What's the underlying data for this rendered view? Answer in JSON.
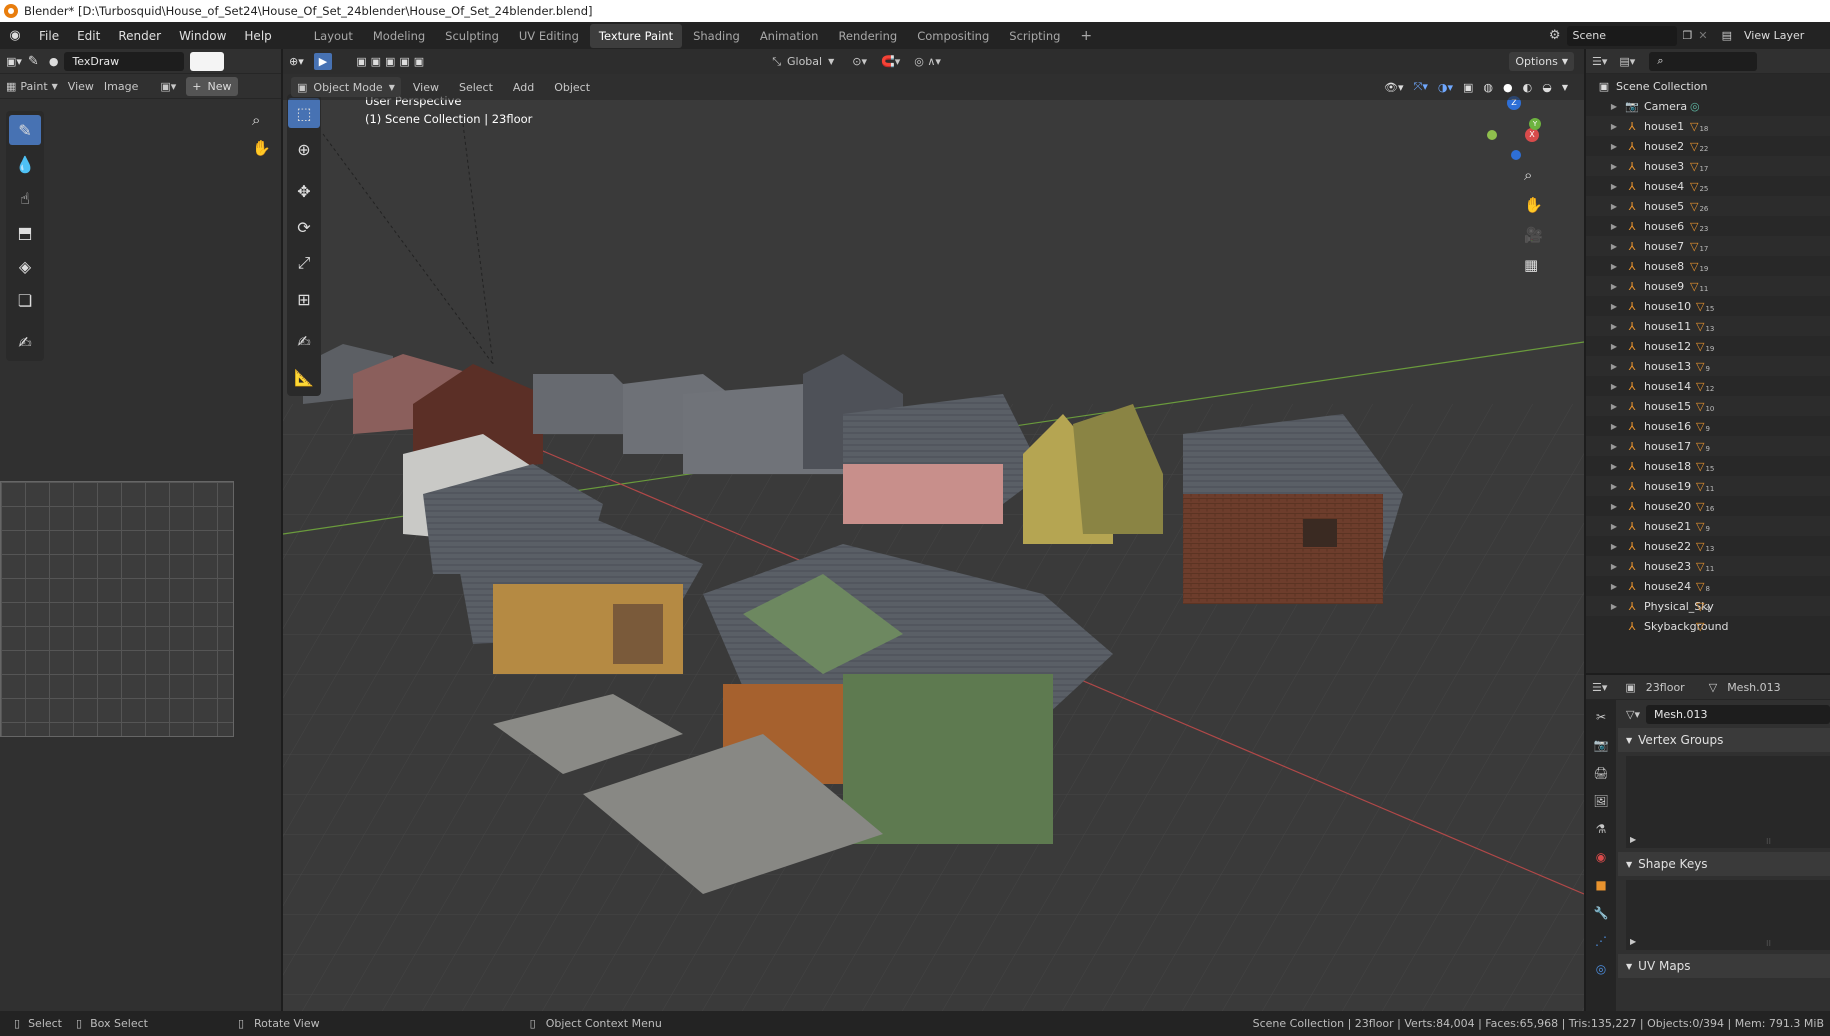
{
  "window": {
    "title": "Blender* [D:\\Turbosquid\\House_of_Set24\\House_Of_Set_24blender\\House_Of_Set_24blender.blend]"
  },
  "menu": {
    "items": [
      "File",
      "Edit",
      "Render",
      "Window",
      "Help"
    ]
  },
  "workspaces": {
    "tabs": [
      "Layout",
      "Modeling",
      "Sculpting",
      "UV Editing",
      "Texture Paint",
      "Shading",
      "Animation",
      "Rendering",
      "Compositing",
      "Scripting"
    ],
    "active": "Texture Paint"
  },
  "scene": {
    "name": "Scene",
    "view_layer": "View Layer"
  },
  "image_editor": {
    "brush_name": "TexDraw",
    "mode": "Paint",
    "menus": [
      "View",
      "Image"
    ],
    "new_label": "New"
  },
  "viewport": {
    "mode": "Object Mode",
    "menus": [
      "View",
      "Select",
      "Add",
      "Object"
    ],
    "orientation": "Global",
    "options_label": "Options",
    "perspective_label": "User Perspective",
    "collection_label": "(1) Scene Collection | 23floor",
    "gizmo_axes": [
      "Z",
      "X",
      "Y"
    ]
  },
  "outliner": {
    "root": "Scene Collection",
    "items": [
      {
        "name": "Camera",
        "count": ""
      },
      {
        "name": "house1",
        "count": "18"
      },
      {
        "name": "house2",
        "count": "22"
      },
      {
        "name": "house3",
        "count": "17"
      },
      {
        "name": "house4",
        "count": "25"
      },
      {
        "name": "house5",
        "count": "26"
      },
      {
        "name": "house6",
        "count": "23"
      },
      {
        "name": "house7",
        "count": "17"
      },
      {
        "name": "house8",
        "count": "19"
      },
      {
        "name": "house9",
        "count": "11"
      },
      {
        "name": "house10",
        "count": "15"
      },
      {
        "name": "house11",
        "count": "13"
      },
      {
        "name": "house12",
        "count": "19"
      },
      {
        "name": "house13",
        "count": "9"
      },
      {
        "name": "house14",
        "count": "12"
      },
      {
        "name": "house15",
        "count": "10"
      },
      {
        "name": "house16",
        "count": "9"
      },
      {
        "name": "house17",
        "count": "9"
      },
      {
        "name": "house18",
        "count": "15"
      },
      {
        "name": "house19",
        "count": "11"
      },
      {
        "name": "house20",
        "count": "16"
      },
      {
        "name": "house21",
        "count": "9"
      },
      {
        "name": "house22",
        "count": "13"
      },
      {
        "name": "house23",
        "count": "11"
      },
      {
        "name": "house24",
        "count": "8"
      },
      {
        "name": "Physical_Sky",
        "count": "4"
      },
      {
        "name": "Skybackground",
        "count": ""
      }
    ]
  },
  "properties": {
    "object_name": "23floor",
    "mesh_name": "Mesh.013",
    "data_field": "Mesh.013",
    "panels": [
      "Vertex Groups",
      "Shape Keys",
      "UV Maps"
    ]
  },
  "statusbar": {
    "select": "Select",
    "box_select": "Box Select",
    "rotate_view": "Rotate View",
    "context_menu": "Object Context Menu",
    "stats": "Scene Collection | 23floor | Verts:84,004 | Faces:65,968 | Tris:135,227 | Objects:0/394 | Mem: 791.3 MiB"
  }
}
